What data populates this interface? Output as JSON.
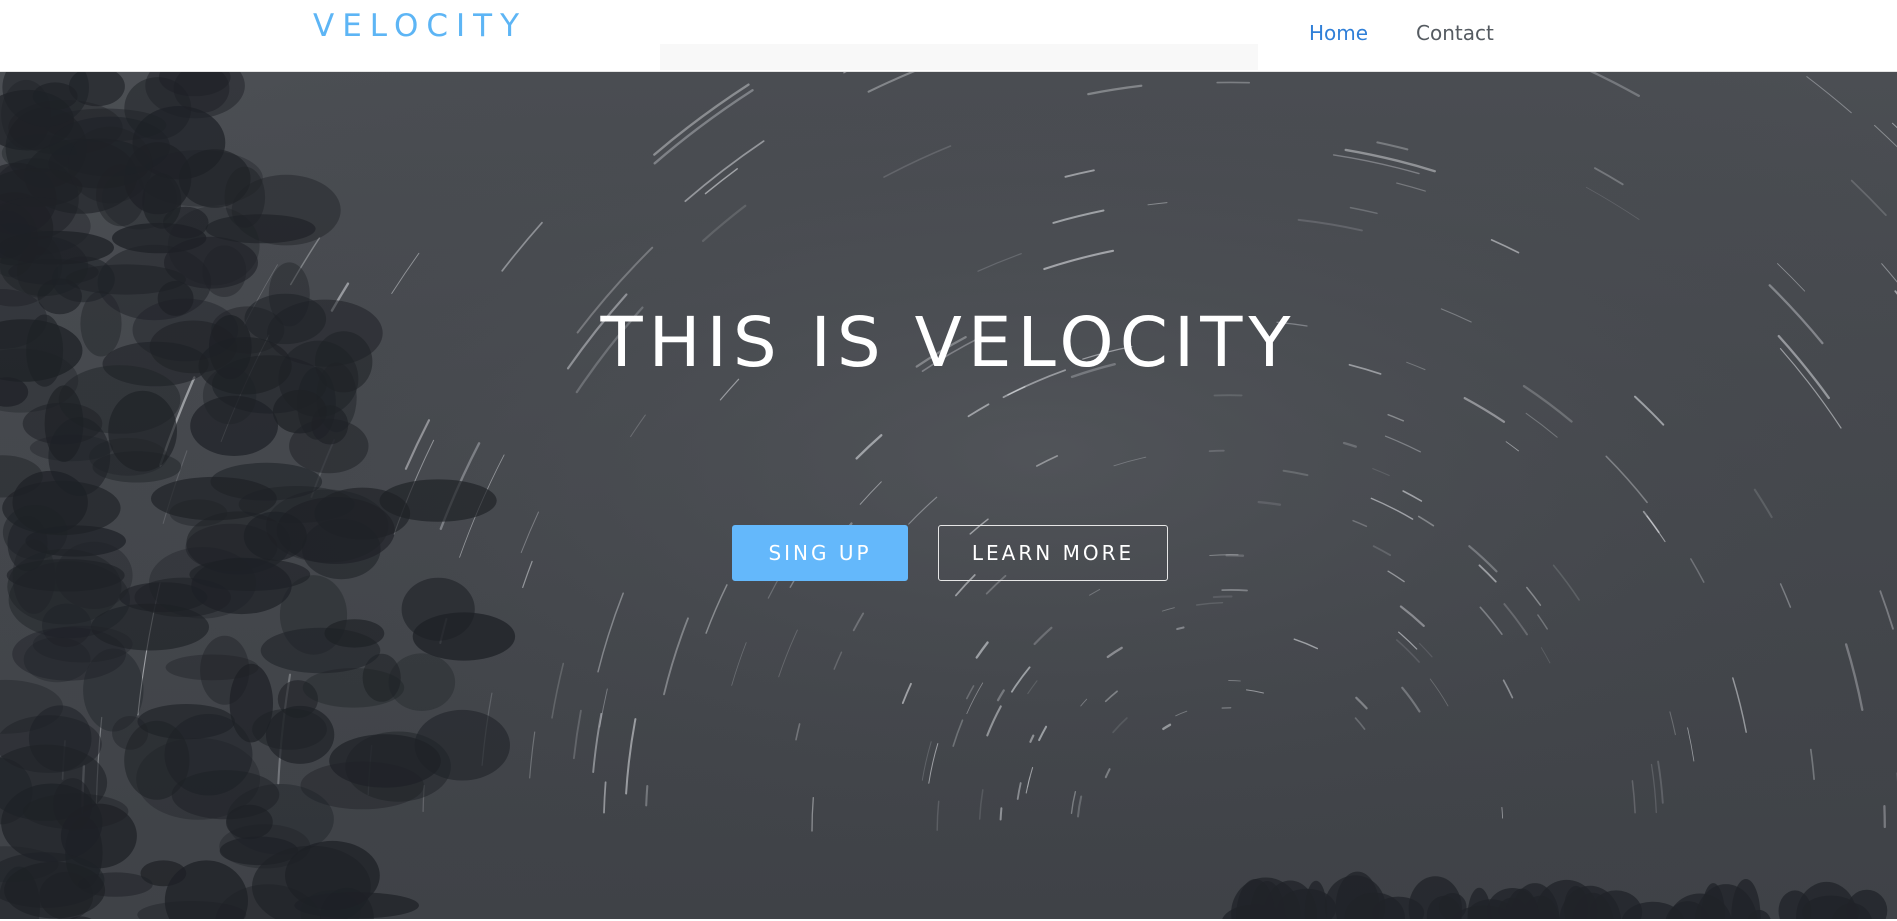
{
  "navbar": {
    "brand": "VELOCITY",
    "links": [
      {
        "label": "Home",
        "active": true
      },
      {
        "label": "Contact",
        "active": false
      }
    ]
  },
  "hero": {
    "title": "THIS IS VELOCITY",
    "primary_button": "SING UP",
    "secondary_button": "LEARN MORE",
    "background": "night sky star trails with tree silhouettes"
  },
  "colors": {
    "accent": "#64b8fb",
    "brand": "#5db5f5",
    "active_link": "#2f7fd8",
    "link": "#555b61",
    "hero_bg": "#46494e"
  }
}
